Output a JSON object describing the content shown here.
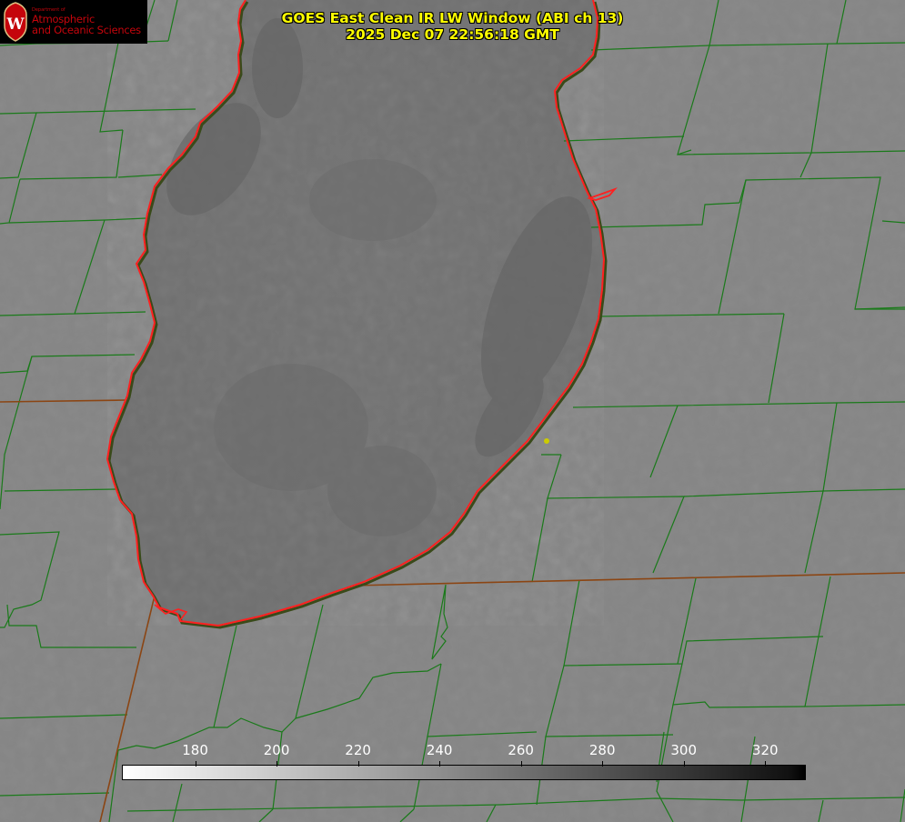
{
  "title": {
    "line1": "GOES East Clean IR LW Window (ABI ch 13)",
    "line2": "2025 Dec 07 22:56:18 GMT"
  },
  "logo": {
    "dept": "Department of",
    "line1": "Atmospheric",
    "line2": "and Oceanic Sciences",
    "letter": "W"
  },
  "colorbar": {
    "min": 162,
    "max": 330,
    "ticks": [
      "180",
      "200",
      "220",
      "240",
      "260",
      "280",
      "300",
      "320"
    ],
    "tick_values": [
      180,
      200,
      220,
      240,
      260,
      280,
      300,
      320
    ],
    "color_low": "#ffffff",
    "color_high": "#000000"
  },
  "colors": {
    "title": "#ffff00",
    "lake_shoreline": "#ff2020",
    "county_lines": "#1a7a1a",
    "state_border": "#8b4513",
    "land": "#858585",
    "lake": "#6a6a6a",
    "station_marker": "#cccc00"
  }
}
